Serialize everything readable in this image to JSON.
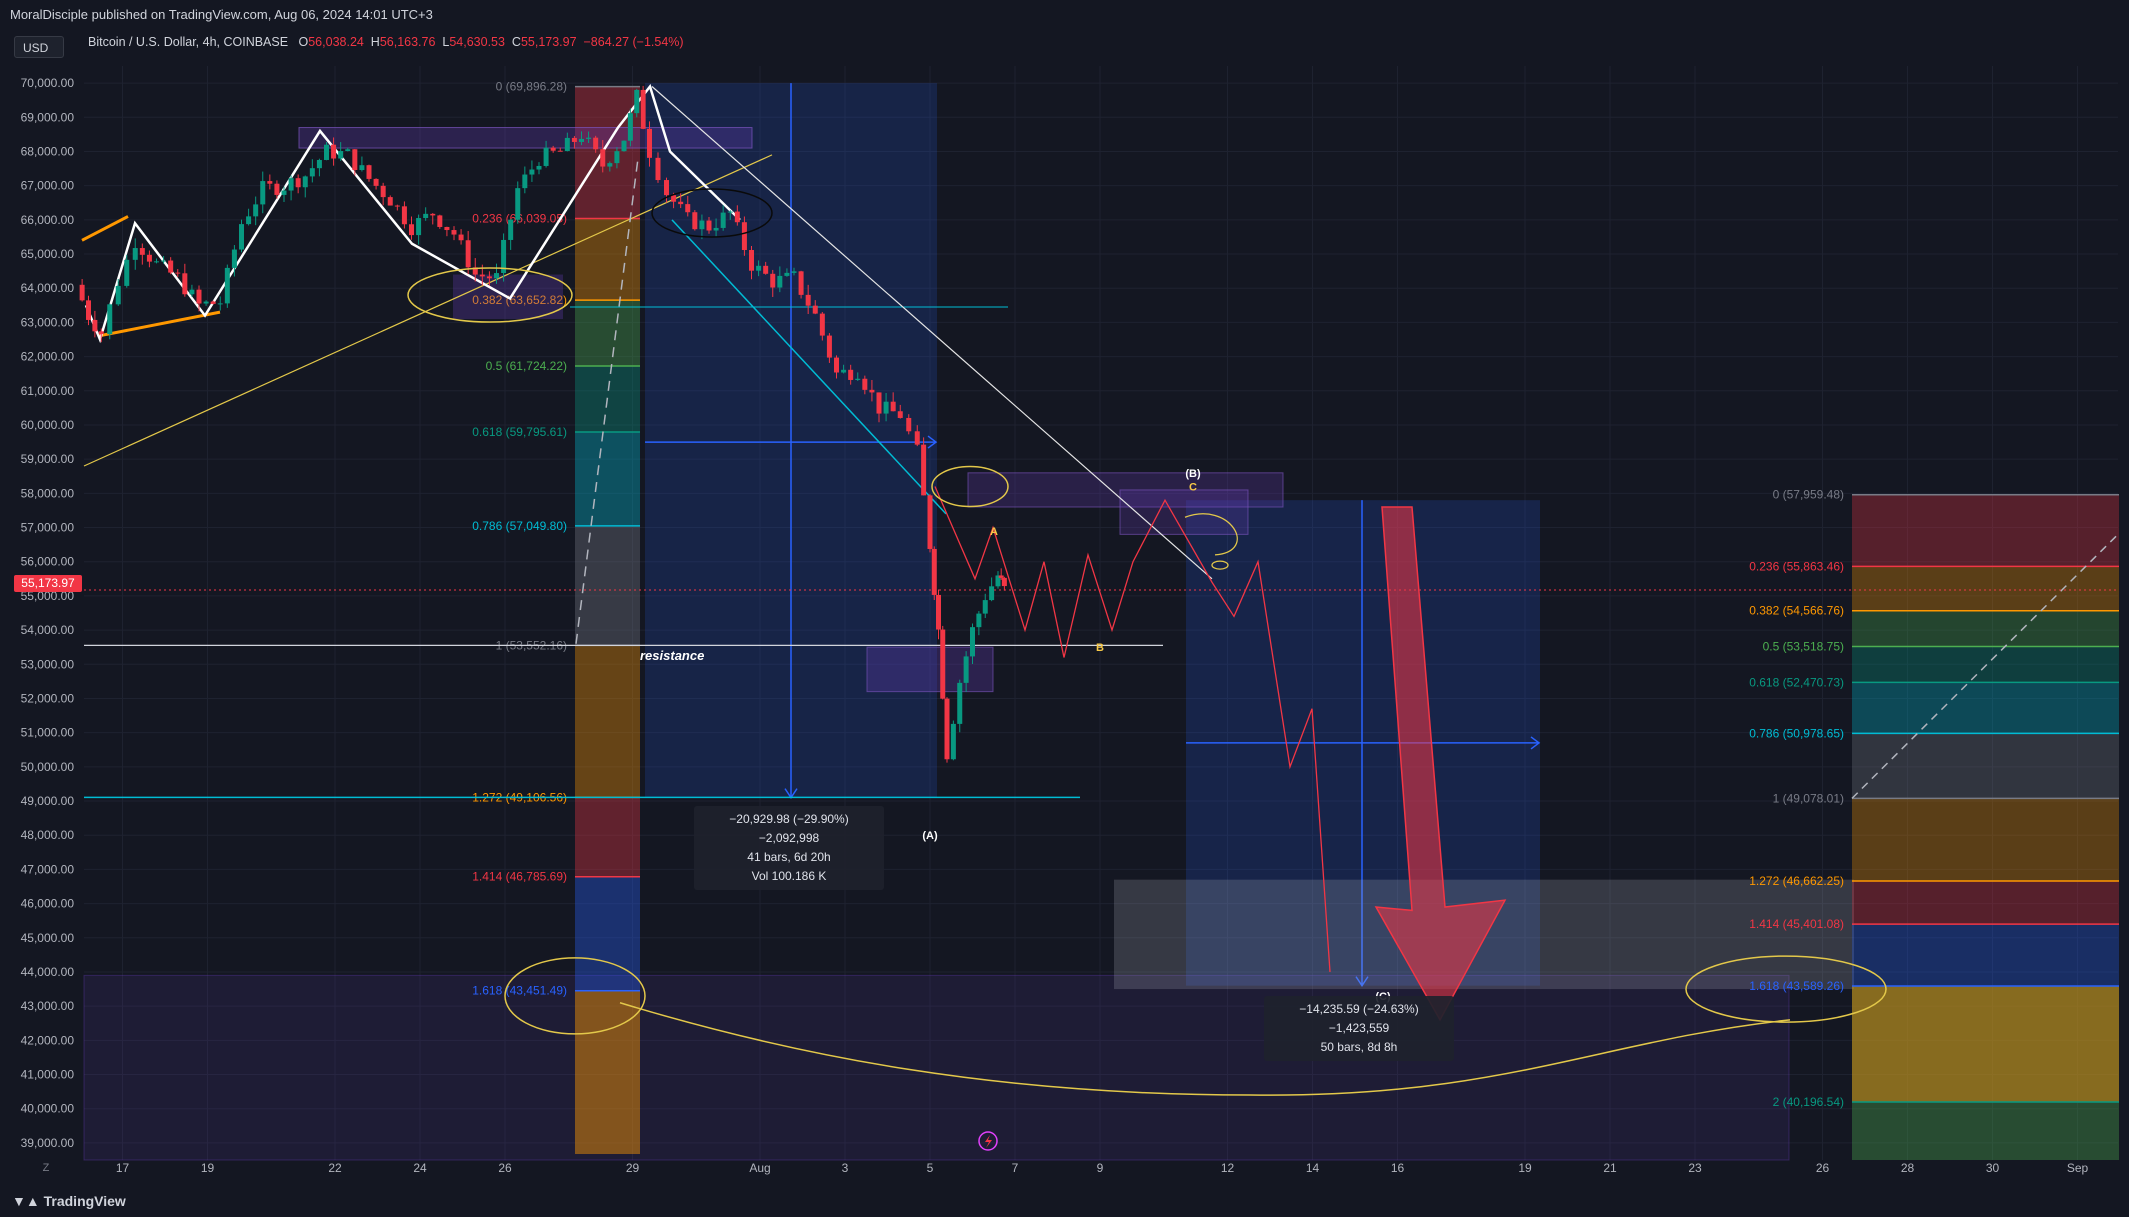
{
  "header": {
    "published_by": "MoralDisciple published on TradingView.com, Aug 06, 2024 14:01 UTC+3",
    "currency_button": "USD",
    "symbol": "Bitcoin / U.S. Dollar, 4h, COINBASE",
    "ohlc": {
      "o_label": "O",
      "o_value": "56,038.24",
      "h_label": "H",
      "h_value": "56,163.76",
      "l_label": "L",
      "l_value": "54,630.53",
      "c_label": "C",
      "c_value": "55,173.97",
      "change": "−864.27 (−1.54%)"
    }
  },
  "current_price_tag": "55,173.97",
  "footer": {
    "brand": "TradingView",
    "z_button": "Z"
  },
  "measure_boxes": [
    {
      "line1": "−20,929.98 (−29.90%) −2,092,998",
      "line2": "41 bars, 6d 20h",
      "line3": "Vol 100.186 K"
    },
    {
      "line1": "−14,235.59 (−24.63%) −1,423,559",
      "line2": "50 bars, 8d 8h"
    }
  ],
  "chart_data": {
    "type": "candlestick",
    "symbol": "Bitcoin / U.S. Dollar",
    "interval": "4h",
    "exchange": "COINBASE",
    "ylim": [
      38500,
      70500
    ],
    "y_ticks": [
      39000,
      40000,
      41000,
      42000,
      43000,
      44000,
      45000,
      46000,
      47000,
      48000,
      49000,
      50000,
      51000,
      52000,
      53000,
      54000,
      55000,
      56000,
      57000,
      58000,
      59000,
      60000,
      61000,
      62000,
      63000,
      64000,
      65000,
      66000,
      67000,
      68000,
      69000,
      70000
    ],
    "y_tick_labels": [
      "39,000.00",
      "40,000.00",
      "41,000.00",
      "42,000.00",
      "43,000.00",
      "44,000.00",
      "45,000.00",
      "46,000.00",
      "47,000.00",
      "48,000.00",
      "49,000.00",
      "50,000.00",
      "51,000.00",
      "52,000.00",
      "53,000.00",
      "54,000.00",
      "55,000.00",
      "56,000.00",
      "57,000.00",
      "58,000.00",
      "59,000.00",
      "60,000.00",
      "61,000.00",
      "62,000.00",
      "63,000.00",
      "64,000.00",
      "65,000.00",
      "66,000.00",
      "67,000.00",
      "68,000.00",
      "69,000.00",
      "70,000.00"
    ],
    "x_ticks": [
      "17",
      "19",
      "22",
      "24",
      "26",
      "29",
      "Aug",
      "3",
      "5",
      "7",
      "9",
      "12",
      "14",
      "16",
      "19",
      "21",
      "23",
      "26",
      "28",
      "30",
      "Sep"
    ],
    "current_price": 55173.97,
    "price_path": [
      {
        "d": 15.9,
        "p": 64100
      },
      {
        "d": 16.2,
        "p": 63200
      },
      {
        "d": 16.5,
        "p": 62700
      },
      {
        "d": 16.9,
        "p": 64200
      },
      {
        "d": 17.3,
        "p": 65400
      },
      {
        "d": 17.8,
        "p": 64700
      },
      {
        "d": 18.3,
        "p": 64300
      },
      {
        "d": 18.8,
        "p": 63500
      },
      {
        "d": 19.3,
        "p": 63600
      },
      {
        "d": 19.8,
        "p": 65900
      },
      {
        "d": 20.3,
        "p": 66900
      },
      {
        "d": 20.8,
        "p": 67000
      },
      {
        "d": 21.3,
        "p": 67300
      },
      {
        "d": 21.8,
        "p": 68000
      },
      {
        "d": 22.3,
        "p": 67900
      },
      {
        "d": 22.8,
        "p": 67200
      },
      {
        "d": 23.3,
        "p": 66600
      },
      {
        "d": 23.8,
        "p": 65800
      },
      {
        "d": 24.3,
        "p": 66200
      },
      {
        "d": 24.8,
        "p": 65600
      },
      {
        "d": 25.3,
        "p": 64400
      },
      {
        "d": 25.8,
        "p": 64300
      },
      {
        "d": 26.3,
        "p": 66900
      },
      {
        "d": 26.8,
        "p": 67800
      },
      {
        "d": 27.3,
        "p": 68000
      },
      {
        "d": 27.8,
        "p": 68500
      },
      {
        "d": 28.3,
        "p": 67600
      },
      {
        "d": 28.8,
        "p": 68400
      },
      {
        "d": 29.1,
        "p": 69600
      },
      {
        "d": 29.4,
        "p": 68000
      },
      {
        "d": 29.8,
        "p": 66800
      },
      {
        "d": 30.3,
        "p": 66000
      },
      {
        "d": 30.8,
        "p": 65800
      },
      {
        "d": 31.3,
        "p": 66200
      },
      {
        "d": 31.8,
        "p": 64700
      },
      {
        "d": 32.3,
        "p": 64200
      },
      {
        "d": 32.8,
        "p": 64300
      },
      {
        "d": 33.3,
        "p": 63200
      },
      {
        "d": 33.8,
        "p": 61500
      },
      {
        "d": 34.3,
        "p": 61600
      },
      {
        "d": 34.8,
        "p": 60500
      },
      {
        "d": 35.3,
        "p": 60300
      },
      {
        "d": 35.7,
        "p": 59200
      },
      {
        "d": 36.0,
        "p": 56500
      },
      {
        "d": 36.2,
        "p": 54000
      },
      {
        "d": 36.4,
        "p": 50400
      },
      {
        "d": 36.7,
        "p": 52500
      },
      {
        "d": 37.0,
        "p": 54000
      },
      {
        "d": 37.3,
        "p": 55000
      },
      {
        "d": 37.6,
        "p": 55600
      },
      {
        "d": 37.75,
        "p": 55174
      }
    ],
    "fib_levels_left": [
      {
        "ratio": "0",
        "price": 69896.28,
        "label": "0 (69,896.28)"
      },
      {
        "ratio": "0.236",
        "price": 66039.05,
        "label": "0.236 (66,039.05)"
      },
      {
        "ratio": "0.382",
        "price": 63652.82,
        "label": "0.382 (63,652.82)"
      },
      {
        "ratio": "0.5",
        "price": 61724.22,
        "label": "0.5 (61,724.22)"
      },
      {
        "ratio": "0.618",
        "price": 59795.61,
        "label": "0.618 (59,795.61)"
      },
      {
        "ratio": "0.786",
        "price": 57049.8,
        "label": "0.786 (57,049.80)"
      },
      {
        "ratio": "1",
        "price": 53552.16,
        "label": "1 (53,552.16)"
      },
      {
        "ratio": "1.272",
        "price": 49106.56,
        "label": "1.272 (49,106.56)"
      },
      {
        "ratio": "1.414",
        "price": 46785.69,
        "label": "1.414 (46,785.69)"
      },
      {
        "ratio": "1.618",
        "price": 43451.49,
        "label": "1.618 (43,451.49)"
      }
    ],
    "fib_levels_right": [
      {
        "ratio": "0",
        "price": 57959.48,
        "label": "0 (57,959.48)"
      },
      {
        "ratio": "0.236",
        "price": 55863.46,
        "label": "0.236 (55,863.46)"
      },
      {
        "ratio": "0.382",
        "price": 54566.76,
        "label": "0.382 (54,566.76)"
      },
      {
        "ratio": "0.5",
        "price": 53518.75,
        "label": "0.5 (53,518.75)"
      },
      {
        "ratio": "0.618",
        "price": 52470.73,
        "label": "0.618 (52,470.73)"
      },
      {
        "ratio": "0.786",
        "price": 50978.65,
        "label": "0.786 (50,978.65)"
      },
      {
        "ratio": "1",
        "price": 49078.01,
        "label": "1 (49,078.01)"
      },
      {
        "ratio": "1.272",
        "price": 46662.25,
        "label": "1.272 (46,662.25)"
      },
      {
        "ratio": "1.414",
        "price": 45401.08,
        "label": "1.414 (45,401.08)"
      },
      {
        "ratio": "1.618",
        "price": 43589.26,
        "label": "1.618 (43,589.26)"
      },
      {
        "ratio": "2",
        "price": 40196.54,
        "label": "2 (40,196.54)"
      }
    ],
    "fib_colors": {
      "0": "#787b86",
      "0.236": "#f23645",
      "0.382": "#ff9800",
      "0.5": "#4caf50",
      "0.618": "#089981",
      "0.786": "#00bcd4",
      "1": "#787b86",
      "1.272": "#ff9800",
      "1.414": "#f23645",
      "1.618": "#2962ff",
      "2": "#089981"
    },
    "annotations": {
      "resistance": "resistance",
      "wave_A": "A",
      "wave_B": "B",
      "wave_C": "C",
      "wave_paren_A": "(A)",
      "wave_paren_B": "(B)",
      "wave_paren_C": "(C)"
    },
    "colors": {
      "bull": "#089981",
      "bear": "#f23645",
      "background": "#141722",
      "grid": "#1e2230"
    }
  }
}
